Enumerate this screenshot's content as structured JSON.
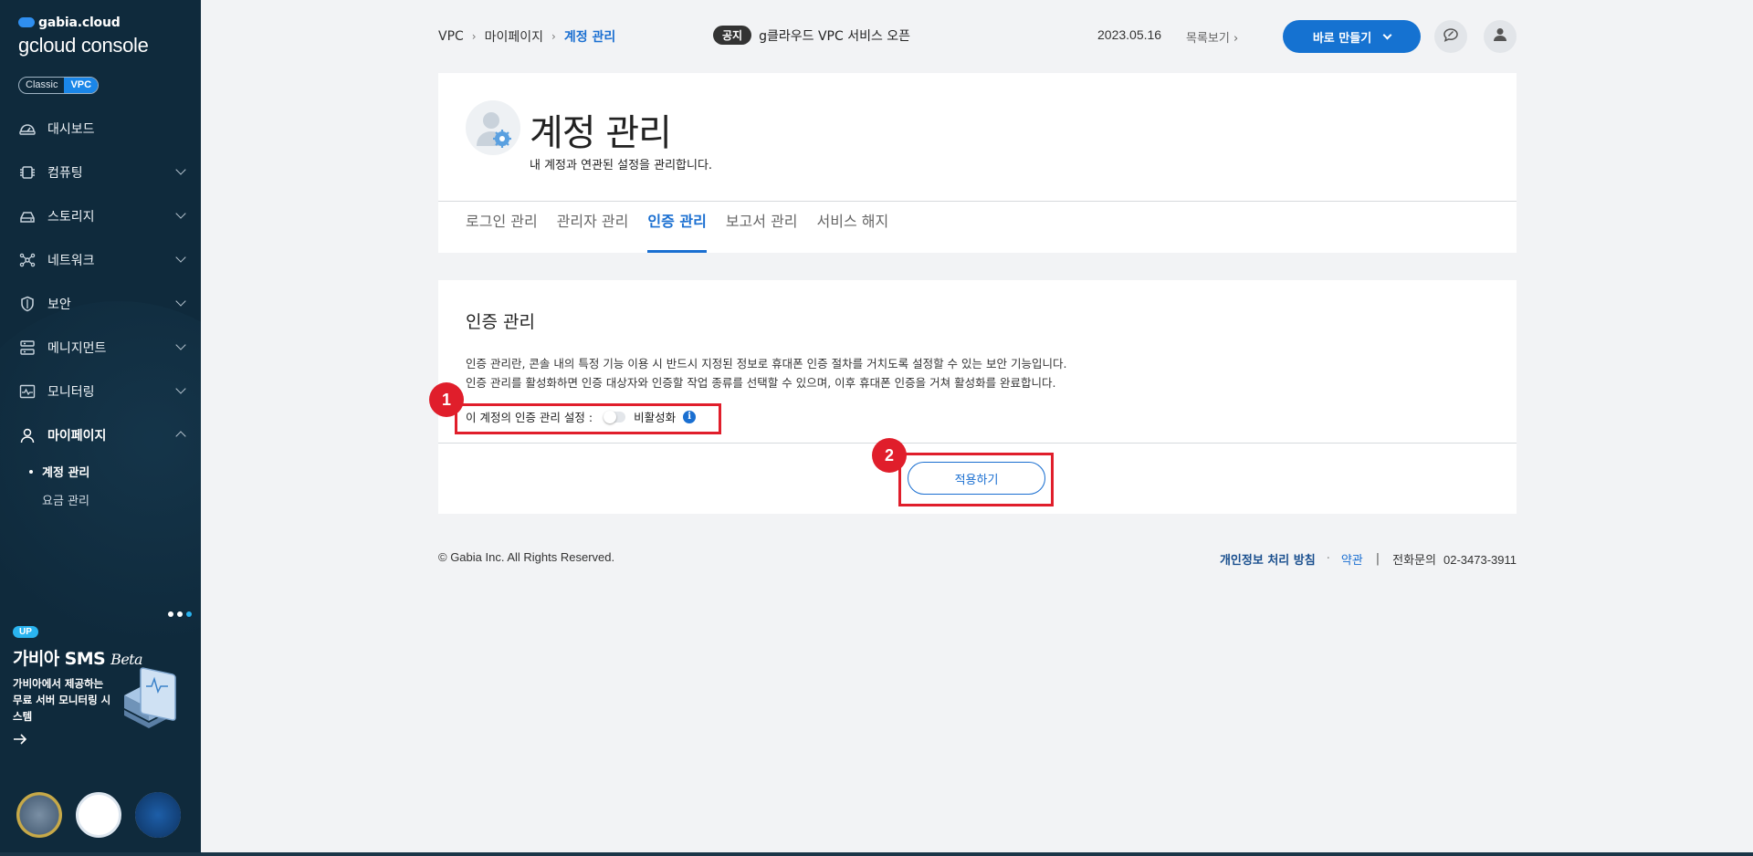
{
  "sidebar": {
    "brand_sub": "gabia.cloud",
    "brand_main": "gcloud console",
    "mode_classic": "Classic",
    "mode_vpc": "VPC",
    "items": [
      {
        "label": "대시보드",
        "icon": "dashboard-icon"
      },
      {
        "label": "컴퓨팅",
        "icon": "chip-icon"
      },
      {
        "label": "스토리지",
        "icon": "storage-icon"
      },
      {
        "label": "네트워크",
        "icon": "network-icon"
      },
      {
        "label": "보안",
        "icon": "shield-icon"
      },
      {
        "label": "메니지먼트",
        "icon": "management-icon"
      },
      {
        "label": "모니터링",
        "icon": "monitoring-icon"
      },
      {
        "label": "마이페이지",
        "icon": "user-icon"
      }
    ],
    "sub_items": [
      {
        "label": "계정 관리"
      },
      {
        "label": "요금 관리"
      }
    ],
    "promo": {
      "badge": "UP",
      "title": "가비아 SMS",
      "title_suffix": "Beta",
      "desc": "가비아에서 제공하는 무료 서버 모니터링 시스템"
    }
  },
  "topbar": {
    "breadcrumb": [
      "VPC",
      "마이페이지",
      "계정 관리"
    ],
    "notice_tag": "공지",
    "notice_text": "g클라우드 VPC 서비스 오픈",
    "notice_date": "2023.05.16",
    "notice_more": "목록보기",
    "create_button": "바로 만들기"
  },
  "header": {
    "title": "계정 관리",
    "desc": "내 계정과 연관된 설정을 관리합니다.",
    "tabs": [
      {
        "label": "로그인 관리"
      },
      {
        "label": "관리자 관리"
      },
      {
        "label": "인증 관리"
      },
      {
        "label": "보고서 관리"
      },
      {
        "label": "서비스 해지"
      }
    ],
    "active_tab": "인증 관리"
  },
  "auth": {
    "title": "인증 관리",
    "line1": "인증 관리란, 콘솔 내의 특정 기능 이용 시 반드시 지정된 정보로 휴대폰 인증 절차를 거치도록 설정할 수 있는 보안 기능입니다.",
    "line2": "인증 관리를 활성화하면 인증 대상자와 인증할 작업 종류를 선택할 수 있으며, 이후 휴대폰 인증을 거쳐 활성화를 완료합니다.",
    "setting_label": "이 계정의 인증 관리 설정 :",
    "toggle_state": "비활성화",
    "apply_button": "적용하기"
  },
  "annotations": {
    "marker1": "1",
    "marker2": "2"
  },
  "footer": {
    "copyright": "© Gabia Inc. All Rights Reserved.",
    "privacy": "개인정보 처리 방침",
    "terms": "약관",
    "tel_label": "전화문의",
    "tel": "02-3473-3911"
  },
  "colors": {
    "sidebar_bg": "#0f2a3c",
    "accent": "#1a6fd1",
    "highlight": "#e01e2b"
  }
}
